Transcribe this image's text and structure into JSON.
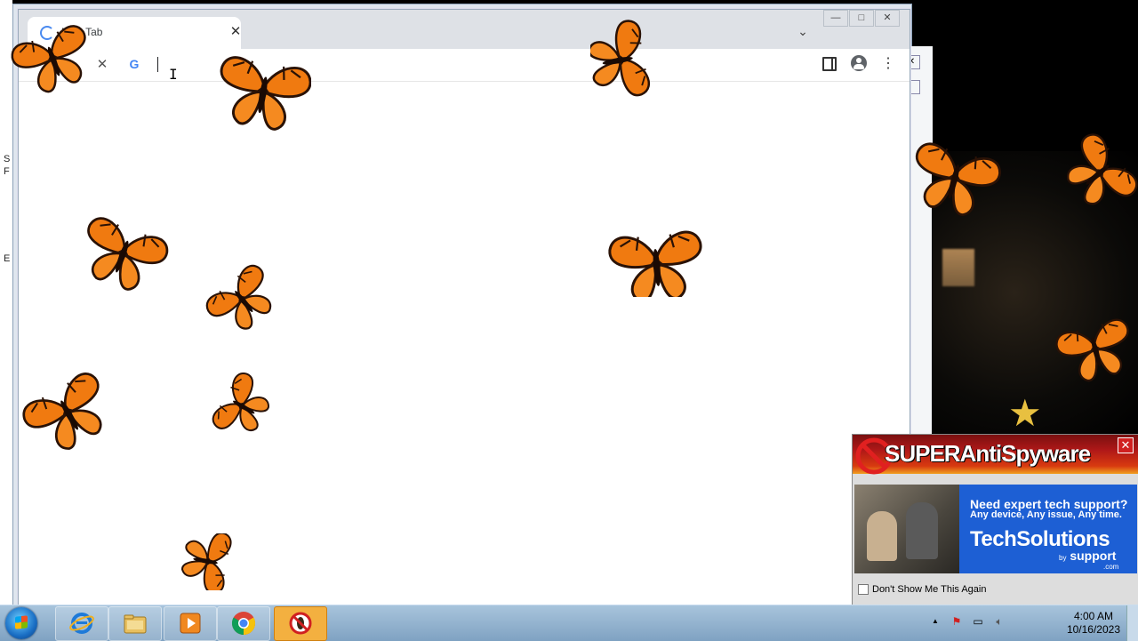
{
  "browser": {
    "tab_title": "New Tab",
    "omnibox_value": "",
    "tab_dropdown_icon": "chevron-down-icon",
    "controls": {
      "minimize": "—",
      "maximize": "□",
      "close": "✕"
    }
  },
  "background_window": {
    "side_letters": [
      "S",
      "F",
      "",
      "",
      "",
      "",
      "",
      "",
      "E"
    ]
  },
  "popup": {
    "brand": "SUPERAntiSpyware",
    "ad_line1": "Need expert tech support?",
    "ad_line2": "Any device, Any issue, Any time.",
    "ad_line3": "TechSolutions",
    "ad_line4": "support",
    "ad_line5": ".com",
    "ad_by": "by",
    "checkbox_label": "Don't Show Me This Again",
    "close": "✕"
  },
  "taskbar": {
    "time": "4:00 AM",
    "date": "10/16/2023",
    "tray_arrow": "▲"
  },
  "colors": {
    "chrome_tabstrip": "#dee1e6",
    "popup_ad_blue": "#1d5fd4",
    "butterfly_orange": "#f07a10",
    "taskbar": "#9ab8d4"
  }
}
